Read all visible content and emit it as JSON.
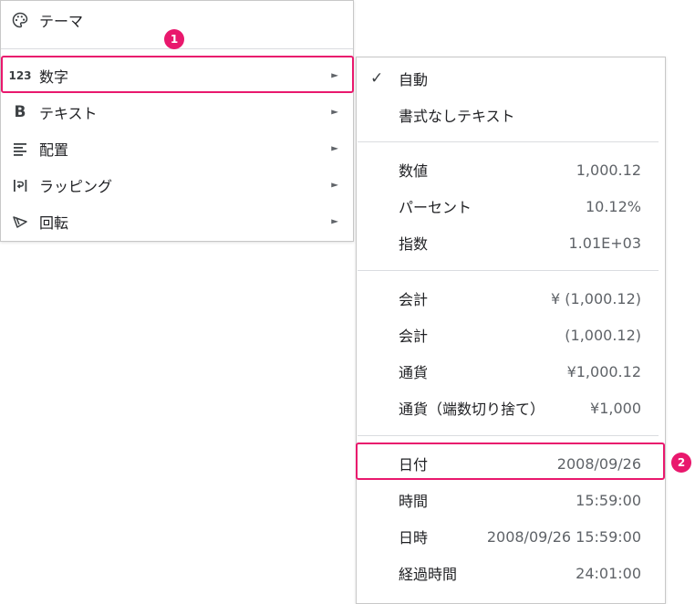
{
  "main_menu": {
    "items": [
      {
        "label": "テーマ",
        "icon": "palette-icon"
      },
      {
        "label": "数字",
        "icon": "number-format-icon",
        "icon_text": "123",
        "submenu": true
      },
      {
        "label": "テキスト",
        "icon": "bold-icon",
        "icon_text": "B",
        "submenu": true
      },
      {
        "label": "配置",
        "icon": "align-left-icon",
        "submenu": true
      },
      {
        "label": "ラッピング",
        "icon": "text-wrap-icon",
        "submenu": true
      },
      {
        "label": "回転",
        "icon": "rotate-text-icon",
        "submenu": true
      }
    ],
    "submenu_arrow": "►"
  },
  "sub_menu": {
    "check": "✓",
    "items": [
      {
        "label": "自動",
        "checked": true
      },
      {
        "label": "書式なしテキスト"
      },
      {
        "label": "数値",
        "sample": "1,000.12"
      },
      {
        "label": "パーセント",
        "sample": "10.12%"
      },
      {
        "label": "指数",
        "sample": "1.01E+03"
      },
      {
        "label": "会計",
        "sample": "¥ (1,000.12)"
      },
      {
        "label": "会計",
        "sample": "(1,000.12)"
      },
      {
        "label": "通貨",
        "sample": "¥1,000.12"
      },
      {
        "label": "通貨（端数切り捨て）",
        "sample": "¥1,000"
      },
      {
        "label": "日付",
        "sample": "2008/09/26"
      },
      {
        "label": "時間",
        "sample": "15:59:00"
      },
      {
        "label": "日時",
        "sample": "2008/09/26 15:59:00"
      },
      {
        "label": "経過時間",
        "sample": "24:01:00"
      }
    ]
  },
  "annotations": {
    "badge_1": "1",
    "badge_2": "2",
    "color": "#e9186d"
  }
}
